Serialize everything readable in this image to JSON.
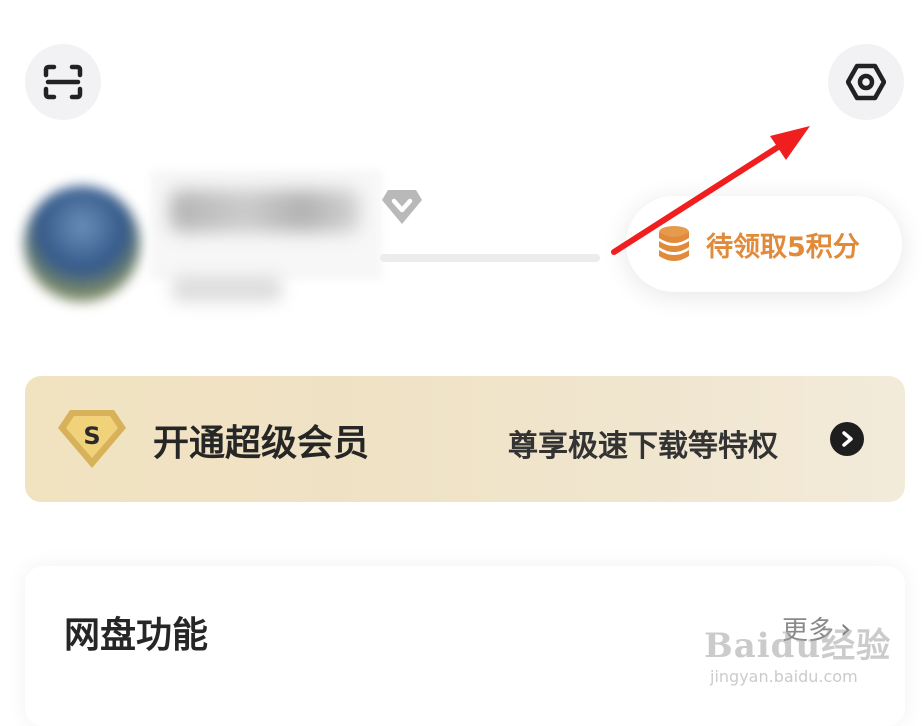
{
  "header": {
    "scan_icon": "scan-icon",
    "settings_icon": "settings-hexagon-icon"
  },
  "profile": {
    "avatar": "avatar",
    "vip_badge_icon": "diamond-badge-icon"
  },
  "points": {
    "icon": "coin-stack-icon",
    "label": "待领取5积分"
  },
  "vip_banner": {
    "icon": "super-vip-s-icon",
    "title": "开通超级会员",
    "subtitle": "尊享极速下载等特权",
    "go_icon": "chevron-right-circle-icon"
  },
  "feature_card": {
    "title": "网盘功能",
    "more_label": "更多",
    "more_icon": "chevron-right-icon"
  },
  "watermark": {
    "main": "Baidu经验",
    "sub": "jingyan.baidu.com"
  },
  "colors": {
    "accent_orange": "#e08a3a",
    "vip_gold": "#d8b25a",
    "annotation_red": "#f01e1e"
  }
}
